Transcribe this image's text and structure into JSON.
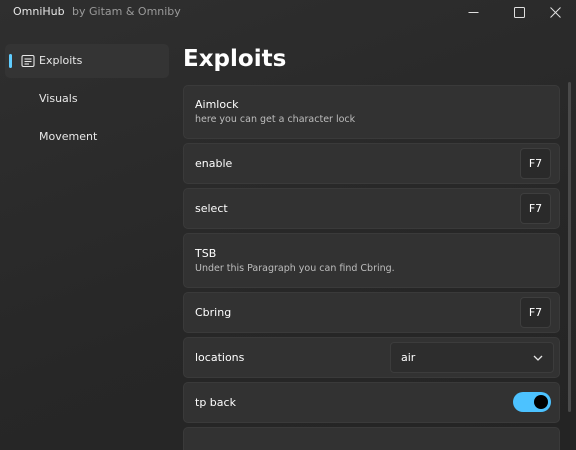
{
  "window": {
    "app_name": "OmniHub",
    "subtitle": "by Gitam & Omniby"
  },
  "sidebar": {
    "items": [
      {
        "label": "Exploits",
        "icon": "document-icon",
        "active": true
      },
      {
        "label": "Visuals",
        "active": false
      },
      {
        "label": "Movement",
        "active": false
      }
    ]
  },
  "main": {
    "title": "Exploits",
    "aimlock": {
      "title": "Aimlock",
      "description": "here you can get a character lock"
    },
    "enable": {
      "label": "enable",
      "key": "F7"
    },
    "select": {
      "label": "select",
      "key": "F7"
    },
    "tsb": {
      "title": "TSB",
      "description": "Under this Paragraph you can find Cbring."
    },
    "cbring": {
      "label": "Cbring",
      "key": "F7"
    },
    "locations": {
      "label": "locations",
      "selected": "air"
    },
    "tp_back": {
      "label": "tp back",
      "enabled": true
    }
  },
  "colors": {
    "accent": "#60cdff",
    "toggle_on": "#4cc2ff",
    "card_bg": "#323232",
    "window_bg": "#2b2b2b"
  }
}
